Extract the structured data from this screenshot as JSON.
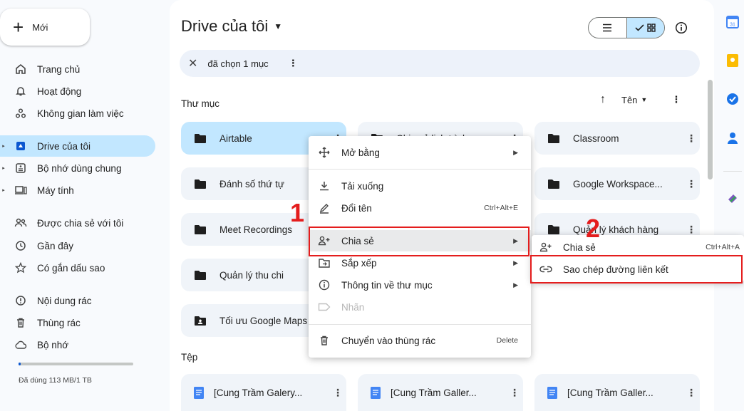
{
  "sidebar": {
    "new_label": "Mới",
    "items": [
      {
        "label": "Trang chủ",
        "icon": "home-icon"
      },
      {
        "label": "Hoạt động",
        "icon": "bell-icon"
      },
      {
        "label": "Không gian làm việc",
        "icon": "workspaces-icon"
      },
      {
        "label": "Drive của tôi",
        "icon": "my-drive-icon"
      },
      {
        "label": "Bộ nhớ dùng chung",
        "icon": "shared-drives-icon"
      },
      {
        "label": "Máy tính",
        "icon": "computer-icon"
      },
      {
        "label": "Được chia sẻ với tôi",
        "icon": "people-icon"
      },
      {
        "label": "Gần đây",
        "icon": "clock-icon"
      },
      {
        "label": "Có gắn dấu sao",
        "icon": "star-icon"
      },
      {
        "label": "Nội dung rác",
        "icon": "spam-icon"
      },
      {
        "label": "Thùng rác",
        "icon": "trash-icon"
      },
      {
        "label": "Bộ nhớ",
        "icon": "cloud-icon"
      }
    ],
    "storage_text": "Đã dùng 113 MB/1 TB",
    "storage_fraction": 0.01
  },
  "header": {
    "title": "Drive của tôi",
    "selection_text": "đã chọn 1 mục"
  },
  "folders_section": {
    "label": "Thư mục",
    "sort_label": "Tên",
    "folders": [
      {
        "name": "Airtable",
        "selected": true,
        "shared": false
      },
      {
        "name": "Chia sẻ lịch trình...",
        "selected": false,
        "shared": false
      },
      {
        "name": "Classroom",
        "selected": false,
        "shared": false
      },
      {
        "name": "Đánh số thứ tự",
        "selected": false,
        "shared": false
      },
      {
        "name": "",
        "selected": false,
        "shared": false
      },
      {
        "name": "Google Workspace...",
        "selected": false,
        "shared": false
      },
      {
        "name": "Meet Recordings",
        "selected": false,
        "shared": false
      },
      {
        "name": "",
        "selected": false,
        "shared": false
      },
      {
        "name": "Quản lý khách hàng",
        "selected": false,
        "shared": false
      },
      {
        "name": "Quản lý thu chi",
        "selected": false,
        "shared": false
      },
      {
        "name": "Tối ưu Google Maps",
        "selected": false,
        "shared": true
      }
    ]
  },
  "files_section": {
    "label": "Tệp",
    "files": [
      {
        "name": "[Cung Trầm Galery..."
      },
      {
        "name": "[Cung Trầm Galler..."
      },
      {
        "name": "[Cung Trầm Galler..."
      }
    ]
  },
  "context_menu": {
    "items": [
      {
        "label": "Mở bằng",
        "icon": "open-with-icon",
        "shortcut": "",
        "submenu": true
      },
      {
        "label": "Tải xuống",
        "icon": "download-icon",
        "shortcut": "",
        "submenu": false
      },
      {
        "label": "Đổi tên",
        "icon": "rename-icon",
        "shortcut": "Ctrl+Alt+E",
        "submenu": false
      },
      {
        "label": "Chia sẻ",
        "icon": "person-add-icon",
        "shortcut": "",
        "submenu": true
      },
      {
        "label": "Sắp xếp",
        "icon": "folder-move-icon",
        "shortcut": "",
        "submenu": true
      },
      {
        "label": "Thông tin về thư mục",
        "icon": "info-icon",
        "shortcut": "",
        "submenu": true
      },
      {
        "label": "Nhãn",
        "icon": "label-icon",
        "shortcut": "",
        "submenu": false
      },
      {
        "label": "Chuyển vào thùng rác",
        "icon": "trash-icon",
        "shortcut": "Delete",
        "submenu": false
      }
    ]
  },
  "share_submenu": {
    "items": [
      {
        "label": "Chia sẻ",
        "icon": "person-add-icon",
        "shortcut": "Ctrl+Alt+A"
      },
      {
        "label": "Sao chép đường liên kết",
        "icon": "link-icon",
        "shortcut": ""
      }
    ]
  },
  "annotations": {
    "step1": "1",
    "step2": "2",
    "color": "#e41d1d"
  },
  "colors": {
    "accent": "#0b57d0",
    "selected_bg": "#c2e7ff",
    "folder_bg": "#f0f4f9"
  }
}
